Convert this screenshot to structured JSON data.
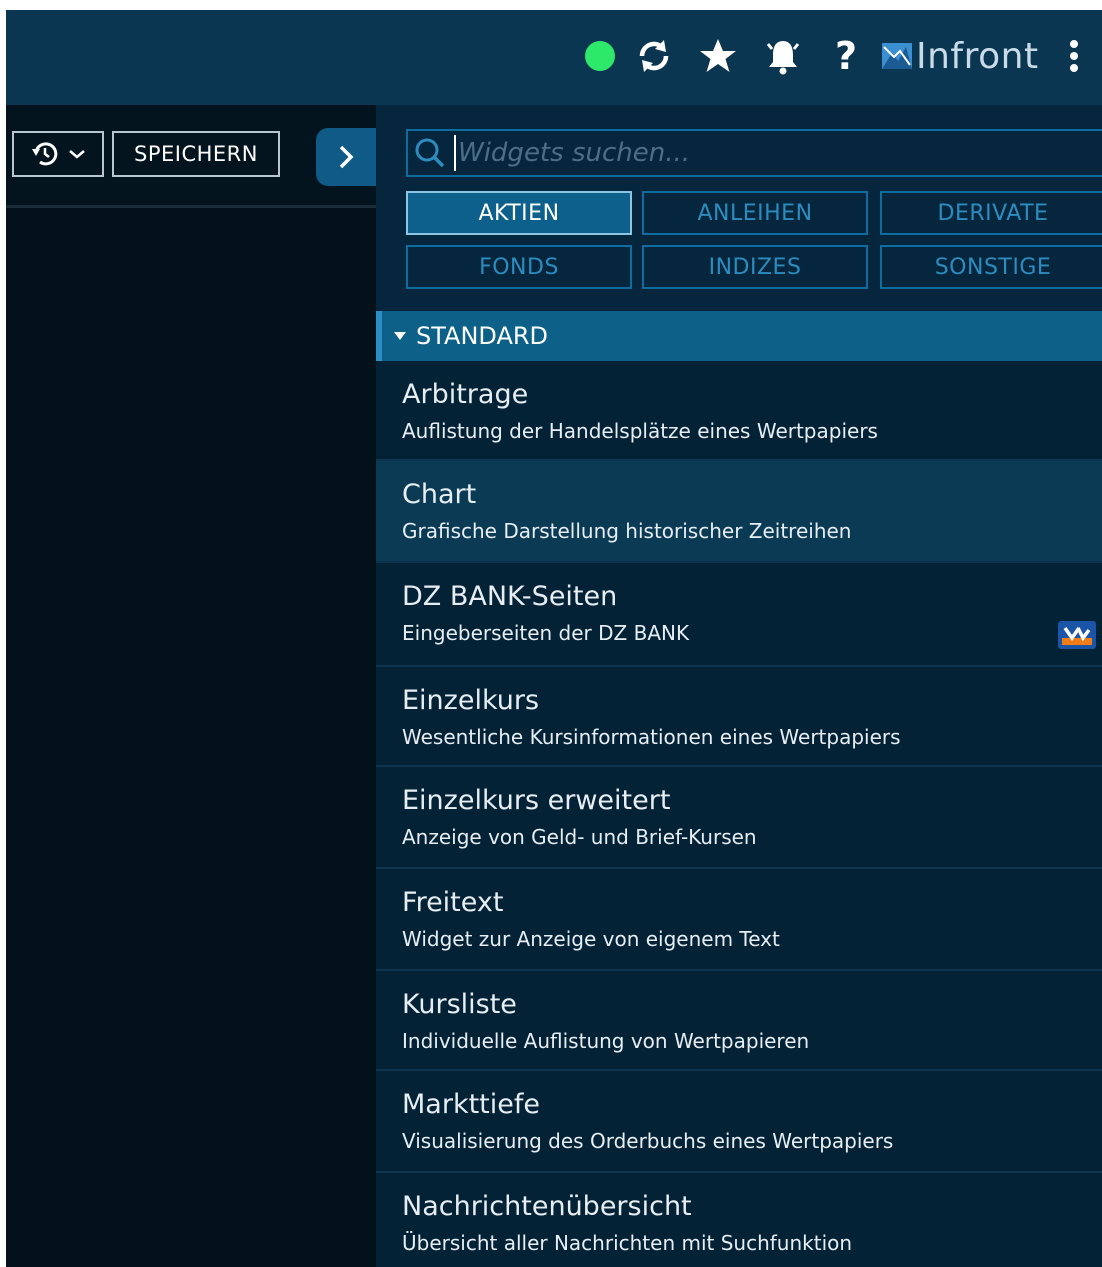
{
  "header": {
    "brand": "Infront",
    "help_label": "?",
    "status_color": "#2ee86a",
    "icons": [
      "status-dot",
      "refresh-icon",
      "star-icon",
      "alarm-bell-icon",
      "help-icon",
      "infront-logo-icon",
      "more-vertical-icon"
    ]
  },
  "toolbar": {
    "history_icon": "history-icon",
    "save_label": "SPEICHERN"
  },
  "panel": {
    "search_placeholder": "Widgets suchen...",
    "categories": [
      {
        "label": "AKTIEN",
        "active": true
      },
      {
        "label": "ANLEIHEN",
        "active": false
      },
      {
        "label": "DERIVATE",
        "active": false
      },
      {
        "label": "FONDS",
        "active": false
      },
      {
        "label": "INDIZES",
        "active": false
      },
      {
        "label": "SONSTIGE",
        "active": false
      }
    ],
    "section_title": "STANDARD",
    "items": [
      {
        "title": "Arbitrage",
        "desc": "Auflistung der Handelsplätze eines Wertpapiers"
      },
      {
        "title": "Chart",
        "desc": "Grafische Darstellung historischer Zeitreihen"
      },
      {
        "title": "DZ BANK-Seiten",
        "desc": "Eingeberseiten der DZ BANK",
        "badge": "dz-bank-logo-icon"
      },
      {
        "title": "Einzelkurs",
        "desc": "Wesentliche Kursinformationen eines Wertpapiers"
      },
      {
        "title": "Einzelkurs erweitert",
        "desc": "Anzeige von Geld- und Brief-Kursen"
      },
      {
        "title": "Freitext",
        "desc": "Widget zur Anzeige von eigenem Text"
      },
      {
        "title": "Kursliste",
        "desc": "Individuelle Auflistung von Wertpapieren"
      },
      {
        "title": "Markttiefe",
        "desc": "Visualisierung des Orderbuchs eines Wertpapiers"
      },
      {
        "title": "Nachrichtenübersicht",
        "desc": "Übersicht aller Nachrichten mit Suchfunktion"
      }
    ]
  }
}
